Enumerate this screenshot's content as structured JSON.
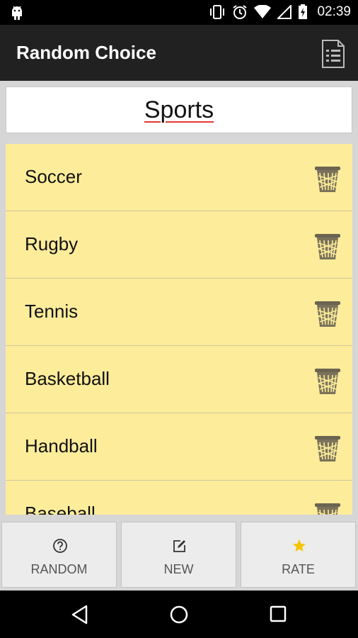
{
  "status_bar": {
    "time": "02:39"
  },
  "app_bar": {
    "title": "Random Choice"
  },
  "category": {
    "name": "Sports"
  },
  "items": [
    {
      "label": "Soccer"
    },
    {
      "label": "Rugby"
    },
    {
      "label": "Tennis"
    },
    {
      "label": "Basketball"
    },
    {
      "label": "Handball"
    },
    {
      "label": "Baseball"
    }
  ],
  "bottom_buttons": {
    "random_label": "RANDOM",
    "new_label": "NEW",
    "rate_label": "RATE"
  },
  "colors": {
    "app_bar": "#212121",
    "list_background": "#fdec9a",
    "star": "#f5c400",
    "underline": "#e53935"
  }
}
